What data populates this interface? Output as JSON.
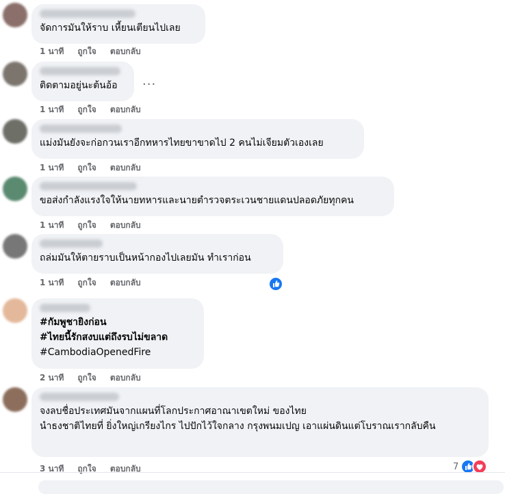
{
  "comments": [
    {
      "text": "จัดการมันให้ราบ เหี้ยนเตียนไปเลย",
      "time": "1 นาที",
      "like": "ถูกใจ",
      "reply": "ตอบกลับ"
    },
    {
      "text": "ติดตามอยู่นะต้นอ้อ",
      "time": "1 นาที",
      "like": "ถูกใจ",
      "reply": "ตอบกลับ"
    },
    {
      "text": "แม่งมันยังจะก่อกวนเราอีกทหารไทยขาขาดไป 2 คนไม่เจียมตัวเองเลย",
      "time": "1 นาที",
      "like": "ถูกใจ",
      "reply": "ตอบกลับ"
    },
    {
      "text": "ขอส่งกำลังแรงใจให้นายทหารและนายตำรวจตระเวนชายแดนปลอดภัยทุกคน",
      "time": "1 นาที",
      "like": "ถูกใจ",
      "reply": "ตอบกลับ"
    },
    {
      "text": "ถล่มมันให้ตายราบเป็นหน้ากองไปเลยมัน ทำเราก่อน",
      "time": "1 นาที",
      "like": "ถูกใจ",
      "reply": "ตอบกลับ"
    },
    {
      "hashtag1": "#กัมพูชายิงก่อน",
      "hashtag2": "#ไทยนี้รักสงบแต่ถึงรบไม่ขลาด",
      "hashtag3": "#CambodiaOpenedFire",
      "time": "2 นาที",
      "like": "ถูกใจ",
      "reply": "ตอบกลับ"
    },
    {
      "text": "จงลบชื่อประเทศมันจากแผนที่โลกประกาศอาณาเขตใหม่ ของไทย\nนำธงชาติไทยที่ ยิ่งใหญ่เกรียงไกร ไปปักไว้ใจกลาง กรุงพนมเปญ เอาแผ่นดินแต่โบราณเรากลับคืน",
      "time": "3 นาที",
      "like": "ถูกใจ",
      "reply": "ตอบกลับ",
      "reaction_count": "7"
    }
  ],
  "more_options": "...",
  "colors": {
    "bubble": "#f0f2f5",
    "like_blue": "#1877f2",
    "love_red": "#f33e58",
    "meta": "#65676b"
  },
  "icons": {
    "like_reaction": "thumbs-up-icon",
    "love_reaction": "heart-icon",
    "more": "more-options-icon"
  }
}
